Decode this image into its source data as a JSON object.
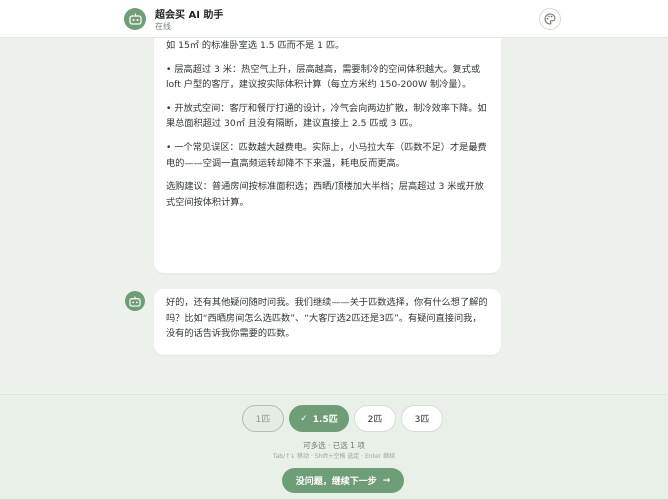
{
  "header": {
    "title": "超会买 AI 助手",
    "status": "在线",
    "avatar_icon": "robot-icon",
    "theme_icon": "palette-icon"
  },
  "messages": [
    {
      "role": "assistant",
      "paragraphs": [
        "如 15㎡ 的标准卧室选 1.5 匹而不是 1 匹。",
        "• 层高超过 3 米：热空气上升，层高越高，需要制冷的空间体积越大。复式或 loft 户型的客厅，建议按实际体积计算（每立方米约 150-200W 制冷量）。",
        "• 开放式空间：客厅和餐厅打通的设计，冷气会向两边扩散，制冷效率下降。如果总面积超过 30㎡ 且没有隔断，建议直接上 2.5 匹或 3 匹。",
        "• 一个常见误区：匹数越大越费电。实际上，小马拉大车（匹数不足）才是最费电的——空调一直高频运转却降不下来温，耗电反而更高。",
        "选购建议：普通房间按标准面积选；西晒/顶楼加大半档；层高超过 3 米或开放式空间按体积计算。"
      ]
    },
    {
      "role": "assistant",
      "paragraphs": [
        "好的，还有其他疑问随时问我。我们继续——关于匹数选择，你有什么想了解的吗？比如“西晒房间怎么选匹数”、“大客厅选2匹还是3匹”。有疑问直接问我，没有的话告诉我你需要的匹数。"
      ]
    }
  ],
  "options": [
    {
      "label": "1匹",
      "state": "disabled"
    },
    {
      "label": "1.5匹",
      "state": "selected"
    },
    {
      "label": "2匹",
      "state": "default"
    },
    {
      "label": "3匹",
      "state": "default"
    }
  ],
  "footer": {
    "multi_hint": "可多选 · 已选 1 项",
    "keys_hint": "Tab/↑↓ 移动 · Shift+空格 选定 · Enter 继续",
    "continue_label": "没问题，继续下一步",
    "continue_icon": "arrow-right-icon"
  },
  "colors": {
    "accent": "#6e9d78",
    "background": "#edf3ec",
    "bubble": "#ffffff"
  }
}
